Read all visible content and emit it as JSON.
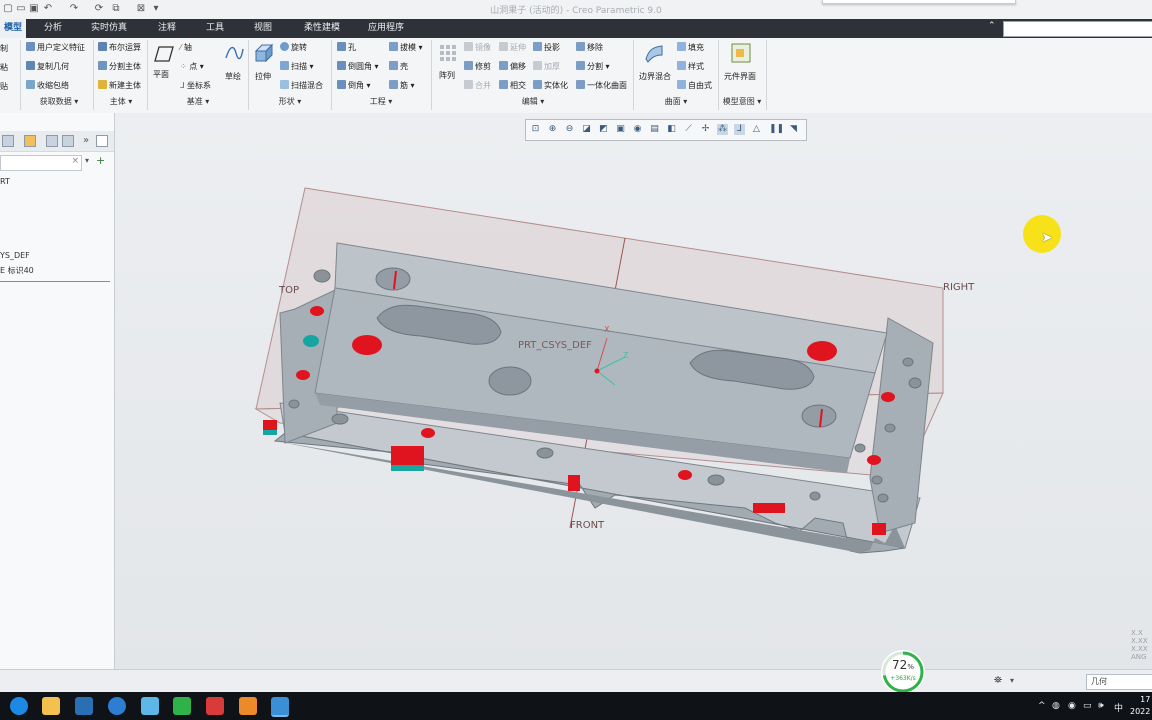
{
  "window": {
    "title": "山洞果子 (活动的) - Creo Parametric 9.0"
  },
  "menu": {
    "tabs": [
      "模型",
      "分析",
      "实时仿真",
      "注释",
      "工具",
      "视图",
      "柔性建模",
      "应用程序"
    ],
    "active": "模型"
  },
  "ribbon": {
    "left_cut": [
      "制",
      "粘",
      "贴"
    ],
    "get_data": {
      "items": [
        "用户定义特征",
        "复制几何",
        "收缩包络"
      ],
      "label": "获取数据"
    },
    "body": {
      "items": [
        "布尔运算",
        "分割主体",
        "新建主体"
      ],
      "label": "主体"
    },
    "datum": {
      "items": [
        "平面",
        "轴",
        "点",
        "坐标系",
        "草绘"
      ],
      "label": "基准"
    },
    "shapes": {
      "items": [
        "拉伸",
        "旋转",
        "扫描",
        "扫描混合"
      ],
      "label": "形状"
    },
    "engineering": {
      "items": [
        "孔",
        "倒圆角",
        "倒角",
        "拔模",
        "壳",
        "筋"
      ],
      "label": "工程"
    },
    "editing": {
      "items": [
        "阵列",
        "镜像",
        "延伸",
        "投影",
        "修剪",
        "偏移",
        "加厚",
        "合并",
        "相交",
        "实体化",
        "移除",
        "分割",
        "一体化曲面"
      ],
      "label": "编辑"
    },
    "surfaces": {
      "items": [
        "边界混合",
        "填充",
        "样式",
        "自由式"
      ],
      "label": "曲面"
    },
    "model_intent": {
      "items": [
        "元件界面"
      ],
      "label": "模型意图"
    }
  },
  "nav": {
    "tree_items": [
      "RT",
      "YS_DEF",
      "E 标识40"
    ]
  },
  "graphics": {
    "labels": {
      "top": "TOP",
      "right": "RIGHT",
      "front": "FRONT",
      "csys": "PRT_CSYS_DEF"
    },
    "csys_axes": [
      "X",
      "Y",
      "Z"
    ],
    "coord_readout": [
      "X.X",
      "X.XX",
      "X.XX",
      "ANG"
    ],
    "colors": {
      "part": "#a5adb4",
      "hole_red": "#e0141e",
      "teal": "#17a5a0",
      "highlight": "#f7e21a"
    }
  },
  "status": {
    "progress_percent": "72",
    "progress_unit": "%",
    "transfer_rate": "+363K/s",
    "filter": "几何"
  },
  "taskbar": {
    "clock_time": "17",
    "clock_date": "2022",
    "ime": "中"
  }
}
